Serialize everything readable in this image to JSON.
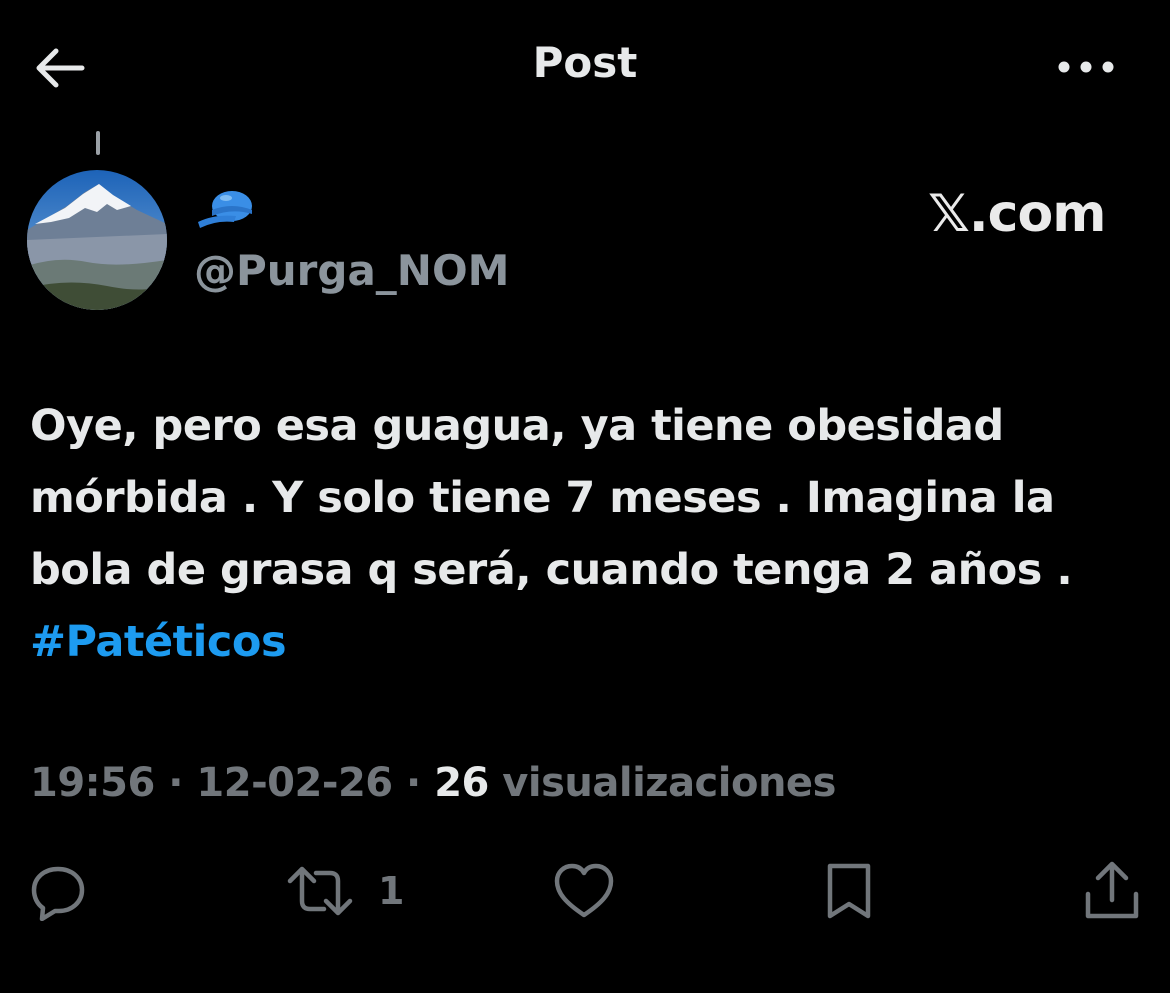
{
  "header": {
    "title": "Post",
    "back_icon": "arrow-left-icon",
    "more_icon": "more-horizontal-icon"
  },
  "author": {
    "handle": "@Purga_NOM",
    "emoji": "blue-cap-emoji",
    "avatar": "snowy-volcano-photo"
  },
  "watermark": "𝕏.com",
  "tweet": {
    "text": "Oye, pero esa guagua, ya tiene obesidad mórbida . Y solo tiene 7 meses . Imagina  la bola de grasa q será, cuando tenga 2 años .",
    "hashtag": "#Patéticos"
  },
  "meta": {
    "time": "19:56",
    "separator": "·",
    "date": "12-02-26",
    "views_count": "26",
    "views_label": "visualizaciones"
  },
  "actions": {
    "reply_icon": "reply-icon",
    "retweet_icon": "retweet-icon",
    "retweet_count": "1",
    "like_icon": "heart-icon",
    "bookmark_icon": "bookmark-icon",
    "share_icon": "share-icon"
  },
  "colors": {
    "background": "#000000",
    "text": "#e7e9ea",
    "muted": "#71767b",
    "accent": "#1d9bf0"
  }
}
